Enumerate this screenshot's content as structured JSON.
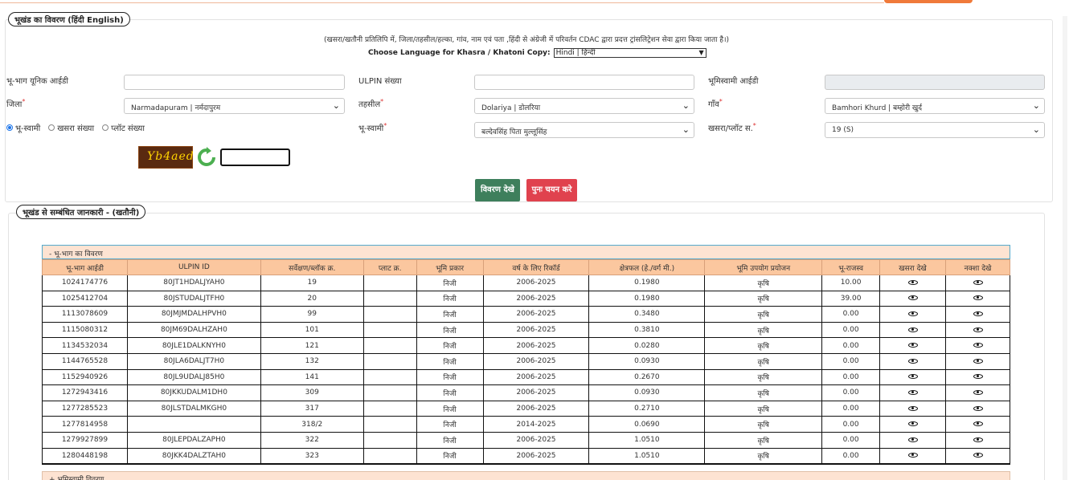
{
  "section1": {
    "legend": "भूखंड का विवरण (हिंदी  English)"
  },
  "notice": "(खसरा/खतौनी प्रतिलिपि में, जिला/तहसील/हल्का, गांव, नाम एवं पता ,हिंदी से अंग्रेजी में परिवर्तन CDAC द्वारा प्रदत्त ट्रांसलिट्रेशन सेवा द्वारा किया जाता है।)",
  "language": {
    "label": "Choose Language for Khasra / Khatoni Copy:",
    "value": "Hindi | हिन्दी"
  },
  "form": {
    "unique_id_label": "भू-भाग यूनिक आईडी",
    "ulpin_label": "ULPIN संख्या",
    "owner_id_label": "भूमिस्वामी आईडी",
    "district_label": "जिला",
    "district_value": "Narmadapuram | नर्मदापुरम",
    "tehsil_label": "तहसील",
    "tehsil_value": "Dolariya | डोलरिया",
    "village_label": "गाँव",
    "village_value": "Bamhori Khurd | बम्होरी खुर्द",
    "owner_label": "भू-स्वामी",
    "owner_value": "बल्देवसिंह पिता मुल्लूसिंह",
    "khasra_label": "खसरा/प्लॉट स.",
    "khasra_value": "19 (S)"
  },
  "search_by": [
    "भू-स्वामी",
    "खसरा संख्या",
    "प्लॉट संख्या"
  ],
  "captcha_text": "Yb4aed",
  "buttons": {
    "view": "विवरण देखे",
    "reset": "पुनः चयन करे"
  },
  "section2": {
    "legend": "भूखंड से सम्बंधित जानकारी -   (खतौनी)",
    "sub_heading": "- भू-भाग का विवरण",
    "sub_heading2": "+ भूमिस्वामी विवरण"
  },
  "table": {
    "columns": [
      "भू-भाग आईडी",
      "ULPIN ID",
      "सर्वेक्षण/ब्लॉक क्र.",
      "प्लाट क्र.",
      "भूमि प्रकार",
      "वर्ष के लिए रिकॉर्ड",
      "क्षेत्रफल (हे./वर्ग मी.)",
      "भूमि उपयोग प्रयोजन",
      "भू-राजस्व",
      "खसरा देखे",
      "नक्शा देखे"
    ],
    "rows": [
      [
        "1024174776",
        "80JT1HDALJYAH0",
        "19",
        "",
        "निजी",
        "2006-2025",
        "0.1980",
        "कृषि",
        "10.00"
      ],
      [
        "1025412704",
        "80JSTUDALJTFH0",
        "20",
        "",
        "निजी",
        "2006-2025",
        "0.1980",
        "कृषि",
        "39.00"
      ],
      [
        "1113078609",
        "80JMJMDALHPVH0",
        "99",
        "",
        "निजी",
        "2006-2025",
        "0.3480",
        "कृषि",
        "0.00"
      ],
      [
        "1115080312",
        "80JM69DALHZAH0",
        "101",
        "",
        "निजी",
        "2006-2025",
        "0.3810",
        "कृषि",
        "0.00"
      ],
      [
        "1134532034",
        "80JLE1DALKNYH0",
        "121",
        "",
        "निजी",
        "2006-2025",
        "0.0280",
        "कृषि",
        "0.00"
      ],
      [
        "1144765528",
        "80JLA6DALJT7H0",
        "132",
        "",
        "निजी",
        "2006-2025",
        "0.0930",
        "कृषि",
        "0.00"
      ],
      [
        "1152940926",
        "80JL9UDALJ85H0",
        "141",
        "",
        "निजी",
        "2006-2025",
        "0.2670",
        "कृषि",
        "0.00"
      ],
      [
        "1272943416",
        "80JKKUDALM1DH0",
        "309",
        "",
        "निजी",
        "2006-2025",
        "0.0930",
        "कृषि",
        "0.00"
      ],
      [
        "1277285523",
        "80JLSTDALMKGH0",
        "317",
        "",
        "निजी",
        "2006-2025",
        "0.2710",
        "कृषि",
        "0.00"
      ],
      [
        "1277814958",
        "",
        "318/2",
        "",
        "निजी",
        "2014-2025",
        "0.0690",
        "कृषि",
        "0.00"
      ],
      [
        "1279927899",
        "80JLEPDALZAPH0",
        "322",
        "",
        "निजी",
        "2006-2025",
        "1.0510",
        "कृषि",
        "0.00"
      ],
      [
        "1280448198",
        "80JKK4DALZTAH0",
        "323",
        "",
        "निजी",
        "2006-2025",
        "1.0510",
        "कृषि",
        "0.00"
      ]
    ]
  },
  "colors": {
    "accent": "#f07a3a",
    "view_btn": "#3e7f5c",
    "reset_btn": "#e0424e",
    "table_head": "#fbc79f"
  }
}
